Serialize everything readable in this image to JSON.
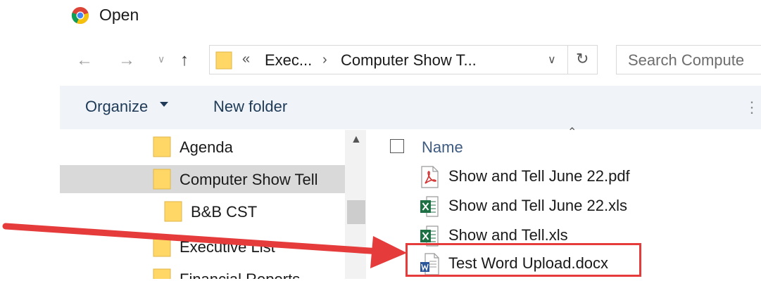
{
  "window": {
    "title": "Open",
    "icon": "chrome-icon"
  },
  "navigation": {
    "back_icon": "arrow-left-icon",
    "forward_icon": "arrow-right-icon",
    "recent_icon": "chevron-down-icon",
    "up_icon": "arrow-up-icon"
  },
  "address_bar": {
    "prefix": "«",
    "segments": [
      "Exec...",
      "Computer Show T..."
    ],
    "separator": "›"
  },
  "search": {
    "placeholder": "Search Compute"
  },
  "toolbar": {
    "organize_label": "Organize",
    "new_folder_label": "New folder"
  },
  "nav_pane": {
    "items": [
      {
        "label": "Agenda",
        "selected": false
      },
      {
        "label": "Computer Show Tell",
        "selected": true
      },
      {
        "label": "B&B CST",
        "selected": false
      },
      {
        "label": "Executive List",
        "selected": false
      },
      {
        "label": "Financial Reports",
        "selected": false
      }
    ]
  },
  "file_list": {
    "column_name": "Name",
    "files": [
      {
        "name": "Show and Tell June 22.pdf",
        "type": "pdf",
        "icon": "pdf-icon"
      },
      {
        "name": "Show and Tell June 22.xls",
        "type": "xls",
        "icon": "excel-icon"
      },
      {
        "name": "Show and Tell.xls",
        "type": "xls",
        "icon": "excel-icon"
      },
      {
        "name": "Test Word Upload.docx",
        "type": "docx",
        "icon": "word-icon"
      }
    ]
  },
  "colors": {
    "accent_blue": "#3d5a80",
    "command_bar": "#f0f4f9",
    "selection": "#d9d9d9",
    "annotation_red": "#e53b3b",
    "folder_yellow": "#ffd767"
  }
}
